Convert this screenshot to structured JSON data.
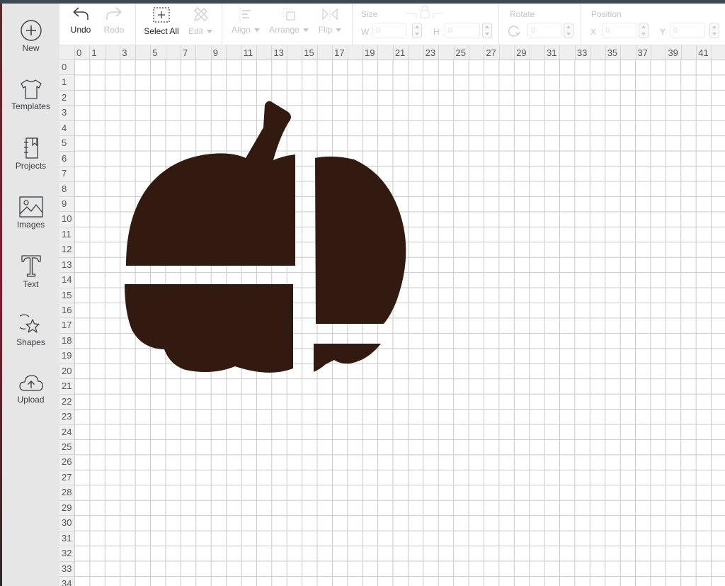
{
  "sidebar": {
    "items": [
      {
        "id": "new",
        "label": "New",
        "icon": "plus-circle-icon"
      },
      {
        "id": "templates",
        "label": "Templates",
        "icon": "tshirt-icon"
      },
      {
        "id": "projects",
        "label": "Projects",
        "icon": "notebook-icon"
      },
      {
        "id": "images",
        "label": "Images",
        "icon": "image-icon"
      },
      {
        "id": "text",
        "label": "Text",
        "icon": "text-t-icon"
      },
      {
        "id": "shapes",
        "label": "Shapes",
        "icon": "shapes-icon"
      },
      {
        "id": "upload",
        "label": "Upload",
        "icon": "cloud-upload-icon"
      }
    ]
  },
  "toolbar": {
    "undo_label": "Undo",
    "redo_label": "Redo",
    "select_all_label": "Select All",
    "edit_label": "Edit",
    "align_label": "Align",
    "arrange_label": "Arrange",
    "flip_label": "Flip",
    "size": {
      "title": "Size",
      "w_label": "W",
      "w_value": "0",
      "h_label": "H",
      "h_value": "0"
    },
    "rotate": {
      "title": "Rotate",
      "value": "0"
    },
    "position": {
      "title": "Position",
      "x_label": "X",
      "x_value": "0",
      "y_label": "Y",
      "y_value": "0"
    }
  },
  "rulers": {
    "horizontal": [
      "0",
      "1",
      "",
      "3",
      "",
      "5",
      "",
      "7",
      "",
      "9",
      "",
      "11",
      "",
      "13",
      "",
      "15",
      "",
      "17",
      "",
      "19",
      "",
      "21",
      "",
      "23",
      "",
      "25",
      "",
      "27",
      "",
      "29",
      "",
      "31",
      "",
      "33",
      "",
      "35",
      "",
      "37",
      "",
      "39",
      "",
      "41",
      ""
    ],
    "vertical": [
      "0",
      "1",
      "2",
      "3",
      "4",
      "5",
      "6",
      "7",
      "8",
      "9",
      "10",
      "11",
      "12",
      "13",
      "14",
      "15",
      "16",
      "17",
      "18",
      "19",
      "20",
      "21",
      "22",
      "23",
      "24",
      "25",
      "26",
      "27",
      "28",
      "29",
      "30",
      "31",
      "32",
      "33",
      "34"
    ]
  },
  "canvas": {
    "design_name": "pumpkin",
    "fill_color": "#331a10",
    "pieces": [
      "pumpkin-top-left",
      "pumpkin-bottom-left",
      "pumpkin-right",
      "pumpkin-bottom-right"
    ]
  }
}
